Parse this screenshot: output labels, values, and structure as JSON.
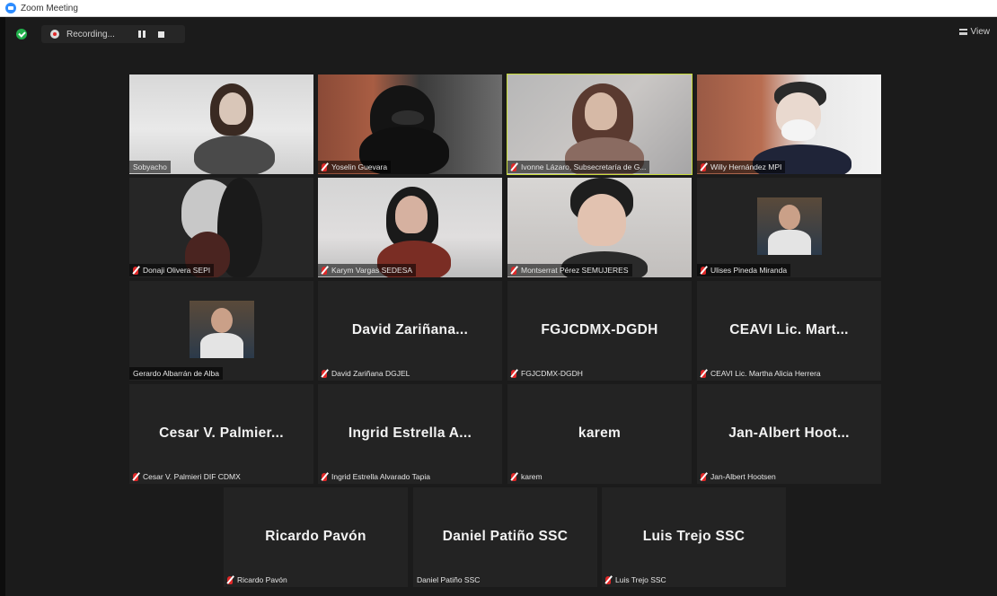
{
  "window": {
    "title": "Zoom Meeting"
  },
  "toolbar": {
    "recording_label": "Recording...",
    "view_label": "View"
  },
  "colors": {
    "active_speaker": "#c8dc39",
    "muted": "#e02828",
    "secure": "#21b04b"
  },
  "participants": [
    {
      "display_name": "Sobyacho",
      "big_label": "",
      "muted": false,
      "video": "room-white"
    },
    {
      "display_name": "Yoselin Guevara",
      "big_label": "",
      "muted": true,
      "video": "room-brick"
    },
    {
      "display_name": "Ivonne Lázaro, Subsecretaría de G...",
      "big_label": "",
      "muted": true,
      "video": "room-grey"
    },
    {
      "display_name": "Willy Hernández MPI",
      "big_label": "",
      "muted": true,
      "video": "room-brick2"
    },
    {
      "display_name": "Donaji Olivera SEPI",
      "big_label": "",
      "muted": true,
      "video": "room-dark"
    },
    {
      "display_name": "Karym Vargas SEDESA",
      "big_label": "",
      "muted": true,
      "video": "room-light"
    },
    {
      "display_name": "Montserrat Pérez SEMUJERES",
      "big_label": "",
      "muted": true,
      "video": "room-plain"
    },
    {
      "display_name": "Ulises Pineda Miranda",
      "big_label": "",
      "muted": true,
      "video": "avatar"
    },
    {
      "display_name": "Gerardo Albarrán de Alba",
      "big_label": "",
      "muted": false,
      "video": "avatar"
    },
    {
      "display_name": "David Zariñana DGJEL",
      "big_label": "David Zariñana...",
      "muted": true,
      "video": "none"
    },
    {
      "display_name": "FGJCDMX-DGDH",
      "big_label": "FGJCDMX-DGDH",
      "muted": true,
      "video": "none"
    },
    {
      "display_name": "CEAVI Lic. Martha Alicia Herrera",
      "big_label": "CEAVI Lic. Mart...",
      "muted": true,
      "video": "none"
    },
    {
      "display_name": "Cesar V. Palmieri DIF CDMX",
      "big_label": "Cesar V. Palmier...",
      "muted": true,
      "video": "none"
    },
    {
      "display_name": "Ingrid Estrella Alvarado Tapia",
      "big_label": "Ingrid Estrella A...",
      "muted": true,
      "video": "none"
    },
    {
      "display_name": "karem",
      "big_label": "karem",
      "muted": true,
      "video": "none"
    },
    {
      "display_name": "Jan-Albert Hootsen",
      "big_label": "Jan-Albert Hoot...",
      "muted": true,
      "video": "none"
    },
    {
      "display_name": "Ricardo Pavón",
      "big_label": "Ricardo Pavón",
      "muted": true,
      "video": "none"
    },
    {
      "display_name": "Daniel Patiño SSC",
      "big_label": "Daniel Patiño SSC",
      "muted": false,
      "video": "none"
    },
    {
      "display_name": "Luis Trejo SSC",
      "big_label": "Luis Trejo SSC",
      "muted": true,
      "video": "none"
    }
  ],
  "active_speaker_index": 2
}
